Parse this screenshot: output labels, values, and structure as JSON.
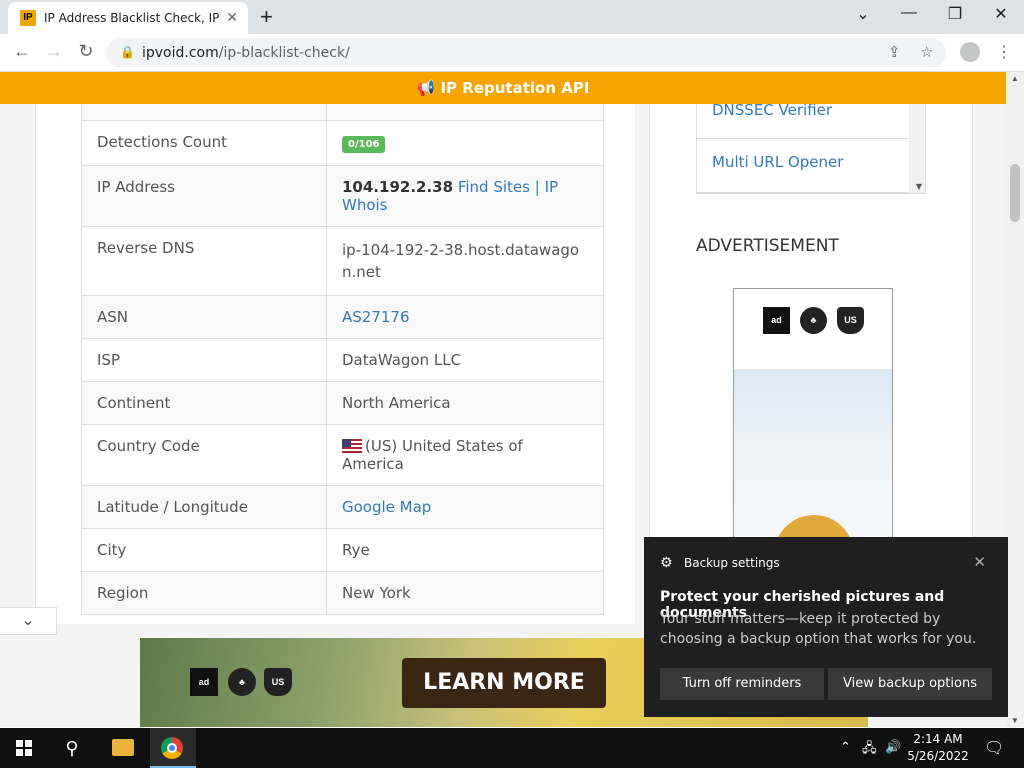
{
  "browser": {
    "tab_title": "IP Address Blacklist Check, IP DNSBL",
    "tab_favicon": "IP",
    "url_domain": "ipvoid.com",
    "url_path": "/ip-blacklist-check/"
  },
  "banner": {
    "text": "📢 IP Reputation API"
  },
  "info_table": {
    "rows": [
      {
        "key": "Detections Count",
        "value": "0/106",
        "type": "badge"
      },
      {
        "key": "IP Address",
        "value": "104.192.2.38",
        "link1": "Find Sites",
        "sep": "|",
        "link2": "IP Whois",
        "type": "ip"
      },
      {
        "key": "Reverse DNS",
        "value": "ip-104-192-2-38.host.datawagon.net",
        "type": "text"
      },
      {
        "key": "ASN",
        "value": "AS27176",
        "type": "link"
      },
      {
        "key": "ISP",
        "value": "DataWagon LLC",
        "type": "text"
      },
      {
        "key": "Continent",
        "value": "North America",
        "type": "text"
      },
      {
        "key": "Country Code",
        "value": "(US) United States of America",
        "type": "flag"
      },
      {
        "key": "Latitude / Longitude",
        "value": "Google Map",
        "type": "link"
      },
      {
        "key": "City",
        "value": "Rye",
        "type": "text"
      },
      {
        "key": "Region",
        "value": "New York",
        "type": "text"
      }
    ]
  },
  "sidebar": {
    "tools": [
      "DNSSEC Verifier",
      "Multi URL Opener"
    ],
    "ad_title": "ADVERTISEMENT",
    "ad_logos": [
      "ad",
      "♣",
      "US"
    ]
  },
  "bottom_ad": {
    "cta": "LEARN MORE",
    "logos": [
      "ad",
      "♣",
      "US"
    ]
  },
  "toast": {
    "app": "Backup settings",
    "title": "Protect your cherished pictures and documents",
    "body": "Your stuff matters—keep it protected by choosing a backup option that works for you.",
    "btn1": "Turn off reminders",
    "btn2": "View backup options"
  },
  "taskbar": {
    "time": "2:14 AM",
    "date": "5/26/2022"
  }
}
